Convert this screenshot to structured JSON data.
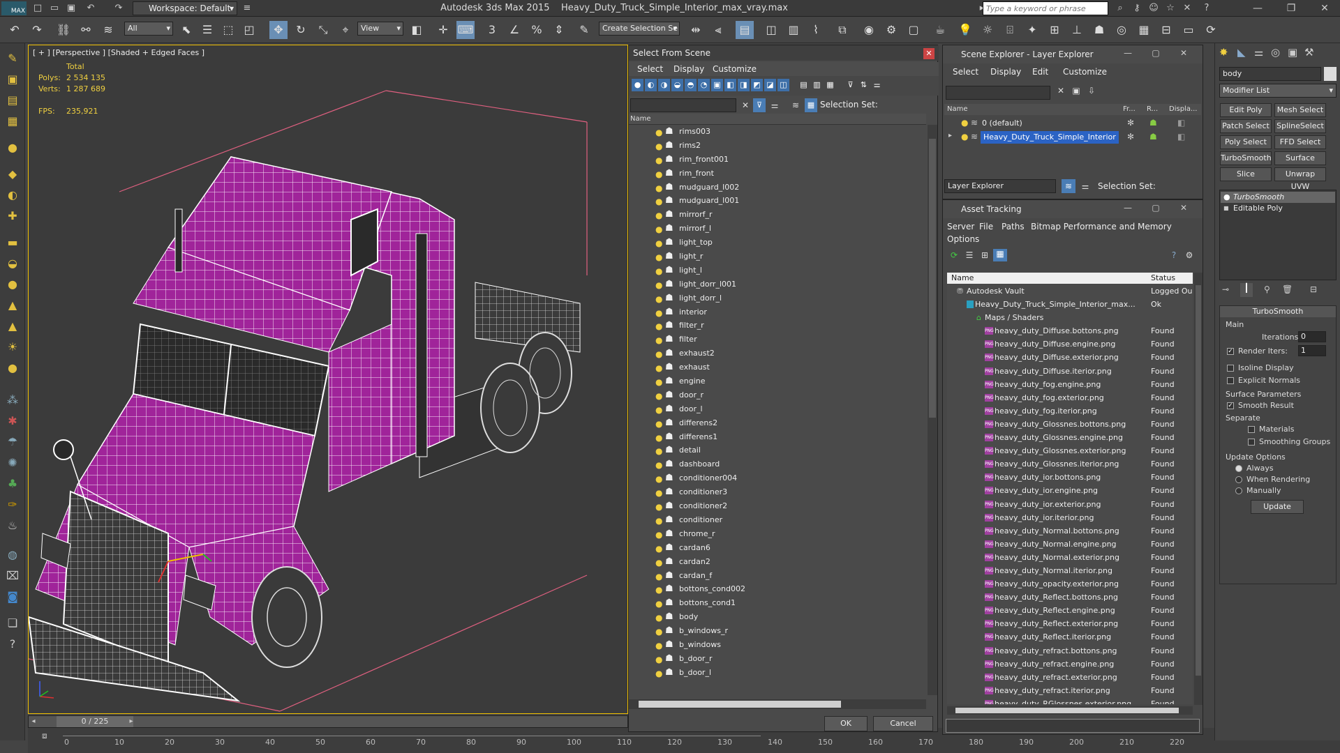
{
  "titlebar": {
    "app_badge": "MAX",
    "workspace": "Workspace: Default",
    "app_name": "Autodesk 3ds Max  2015",
    "file_name": "Heavy_Duty_Truck_Simple_Interior_max_vray.max",
    "search_placeholder": "Type a keyword or phrase"
  },
  "toolbar": {
    "filter_value": "All",
    "ref_coord": "View",
    "selection_set_placeholder": "Create Selection Se",
    "snap_label": "3",
    "percent_label": "%"
  },
  "viewport": {
    "label": "[ + ] [Perspective ] [Shaded + Edged Faces ]",
    "stats": {
      "total_label": "Total",
      "polys_label": "Polys:",
      "polys_value": "2 534 135",
      "verts_label": "Verts:",
      "verts_value": "1 287 689",
      "fps_label": "FPS:",
      "fps_value": "235,921"
    }
  },
  "timeslider": {
    "frame": "0 / 225",
    "ticks": [
      "0",
      "10",
      "20",
      "30",
      "40",
      "50",
      "60",
      "70",
      "80",
      "90",
      "100",
      "110",
      "120",
      "130",
      "140",
      "150",
      "160",
      "170",
      "180",
      "190",
      "200",
      "210",
      "220"
    ]
  },
  "select_from_scene": {
    "title": "Select From Scene",
    "menu": [
      "Select",
      "Display",
      "Customize"
    ],
    "selection_set_label": "Selection Set:",
    "col_name": "Name",
    "items": [
      "rims003",
      "rims2",
      "rim_front001",
      "rim_front",
      "mudguard_l002",
      "mudguard_l001",
      "mirrorf_r",
      "mirrorf_l",
      "light_top",
      "light_r",
      "light_l",
      "light_dorr_l001",
      "light_dorr_l",
      "interior",
      "filter_r",
      "filter",
      "exhaust2",
      "exhaust",
      "engine",
      "door_r",
      "door_l",
      "differens2",
      "differens1",
      "detail",
      "dashboard",
      "conditioner004",
      "conditioner3",
      "conditioner2",
      "conditioner",
      "chrome_r",
      "cardan6",
      "cardan2",
      "cardan_f",
      "bottons_cond002",
      "bottons_cond1",
      "body",
      "b_windows_r",
      "b_windows",
      "b_door_r",
      "b_door_l"
    ],
    "ok": "OK",
    "cancel": "Cancel"
  },
  "scene_explorer": {
    "title": "Scene Explorer - Layer Explorer",
    "menu": [
      "Select",
      "Display",
      "Edit",
      "Customize"
    ],
    "cols": [
      "Name",
      "Fr...",
      "R...",
      "Displa..."
    ],
    "layers": [
      "0 (default)",
      "Heavy_Duty_Truck_Simple_Interior"
    ],
    "footer_dropdown": "Layer Explorer",
    "selection_set_label": "Selection Set:"
  },
  "asset_tracking": {
    "title": "Asset Tracking",
    "menu": [
      "Server",
      "File",
      "Paths",
      "Bitmap Performance and Memory"
    ],
    "menu2": [
      "Options"
    ],
    "col_name": "Name",
    "col_status": "Status",
    "vault": {
      "name": "Autodesk Vault",
      "status": "Logged Ou"
    },
    "file": {
      "name": "Heavy_Duty_Truck_Simple_Interior_max...",
      "status": "Ok"
    },
    "maps_folder": "Maps / Shaders",
    "png_badge": "PNG",
    "maps": [
      "heavy_duty_Diffuse.bottons.png",
      "heavy_duty_Diffuse.engine.png",
      "heavy_duty_Diffuse.exterior.png",
      "heavy_duty_Diffuse.iterior.png",
      "heavy_duty_fog.engine.png",
      "heavy_duty_fog.exterior.png",
      "heavy_duty_fog.iterior.png",
      "heavy_duty_Glossnes.bottons.png",
      "heavy_duty_Glossnes.engine.png",
      "heavy_duty_Glossnes.exterior.png",
      "heavy_duty_Glossnes.iterior.png",
      "heavy_duty_ior.bottons.png",
      "heavy_duty_ior.engine.png",
      "heavy_duty_ior.exterior.png",
      "heavy_duty_ior.iterior.png",
      "heavy_duty_Normal.bottons.png",
      "heavy_duty_Normal.engine.png",
      "heavy_duty_Normal.exterior.png",
      "heavy_duty_Normal.iterior.png",
      "heavy_duty_opacity.exterior.png",
      "heavy_duty_Reflect.bottons.png",
      "heavy_duty_Reflect.engine.png",
      "heavy_duty_Reflect.exterior.png",
      "heavy_duty_Reflect.iterior.png",
      "heavy_duty_refract.bottons.png",
      "heavy_duty_refract.engine.png",
      "heavy_duty_refract.exterior.png",
      "heavy_duty_refract.iterior.png",
      "heavy_duty_RGlossnes.exterior.png"
    ],
    "map_status": "Found"
  },
  "command_panel": {
    "object_name": "body",
    "modifier_list": "Modifier List",
    "buttons": [
      "Edit Poly",
      "Mesh Select",
      "Patch Select",
      "SplineSelect",
      "Poly Select",
      "FFD Select",
      "TurboSmooth",
      "Surface Select",
      "Slice",
      "Unwrap UVW"
    ],
    "stack": [
      "TurboSmooth",
      "Editable Poly"
    ],
    "rollout_title": "TurboSmooth",
    "main_label": "Main",
    "iterations_label": "Iterations:",
    "iterations_value": "0",
    "render_iters_label": "Render Iters:",
    "render_iters_value": "1",
    "isoline": "Isoline Display",
    "explicit_normals": "Explicit Normals",
    "surface_params": "Surface Parameters",
    "smooth_result": "Smooth Result",
    "separate": "Separate",
    "materials": "Materials",
    "smoothing_groups": "Smoothing Groups",
    "update_options": "Update Options",
    "always": "Always",
    "when_rendering": "When Rendering",
    "manually": "Manually",
    "update": "Update"
  },
  "colors": {
    "body_magenta": "#a0249a",
    "wire": "#ffffff",
    "selection_blue": "#2b63c4",
    "viewport_border": "#f0c000"
  }
}
